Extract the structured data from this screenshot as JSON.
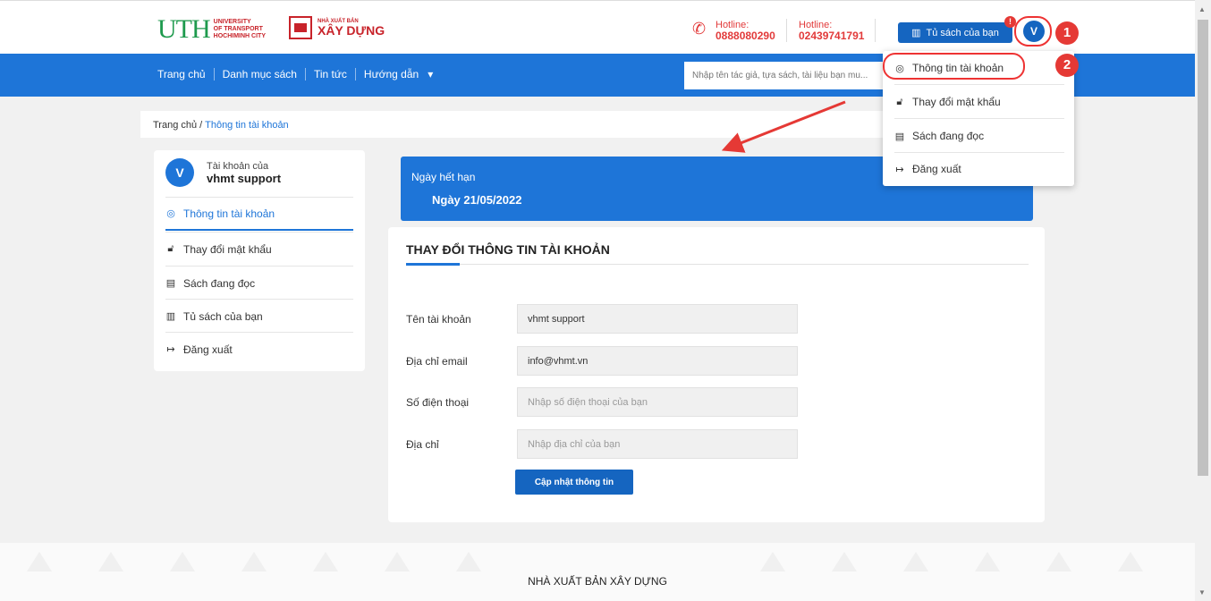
{
  "header": {
    "uth_logo_big": "UTH",
    "uth_logo_small": "UNIVERSITY\nOF TRANSPORT\nHOCHIMINH CITY",
    "publisher_small": "NHÀ XUẤT BẢN",
    "publisher_big": "XÂY DỰNG",
    "hotline1_label": "Hotline:",
    "hotline1_number": "0888080290",
    "hotline2_label": "Hotline:",
    "hotline2_number": "02439741791",
    "bookshelf_button": "Tủ sách của bạn",
    "notification_count": "!",
    "avatar_initial": "V",
    "callout1": "1",
    "callout2": "2"
  },
  "nav": {
    "items": [
      "Trang chủ",
      "Danh mục sách",
      "Tin tức",
      "Hướng dẫn"
    ],
    "dropdown_caret": "▾",
    "search_placeholder": "Nhập tên tác giả, tựa sách, tài liệu bạn mu..."
  },
  "breadcrumb": {
    "home": "Trang chủ",
    "sep": " / ",
    "current": "Thông tin tài khoản"
  },
  "sidebar": {
    "avatar_initial": "V",
    "account_of": "Tài khoản của",
    "username": "vhmt support",
    "items": [
      {
        "label": "Thông tin tài khoản",
        "icon": "user-circle-icon"
      },
      {
        "label": "Thay đổi mật khẩu",
        "icon": "lock-icon"
      },
      {
        "label": "Sách đang đọc",
        "icon": "book-icon"
      },
      {
        "label": "Tủ sách của bạn",
        "icon": "bookshelf-icon"
      },
      {
        "label": "Đăng xuất",
        "icon": "logout-icon"
      }
    ]
  },
  "expiry": {
    "label": "Ngày hết hạn",
    "date": "Ngày 21/05/2022"
  },
  "form": {
    "title": "THAY ĐỔI THÔNG TIN TÀI KHOẢN",
    "fields": [
      {
        "label": "Tên tài khoản",
        "value": "vhmt support",
        "placeholder": ""
      },
      {
        "label": "Địa chỉ email",
        "value": "info@vhmt.vn",
        "placeholder": ""
      },
      {
        "label": "Số điện thoại",
        "value": "",
        "placeholder": "Nhập số điện thoại của bạn"
      },
      {
        "label": "Địa chỉ",
        "value": "",
        "placeholder": "Nhập địa chỉ của bạn"
      }
    ],
    "submit": "Cập nhật thông tin"
  },
  "dropdown": {
    "items": [
      "Thông tin tài khoản",
      "Thay đổi mật khẩu",
      "Sách đang đọc",
      "Đăng xuất"
    ]
  },
  "footer": {
    "title": "NHÀ XUẤT BẢN XÂY DỰNG"
  },
  "colors": {
    "primary": "#1e75d8",
    "button": "#1565c0",
    "hotline": "#e23a3a",
    "annotation": "#e53935"
  }
}
